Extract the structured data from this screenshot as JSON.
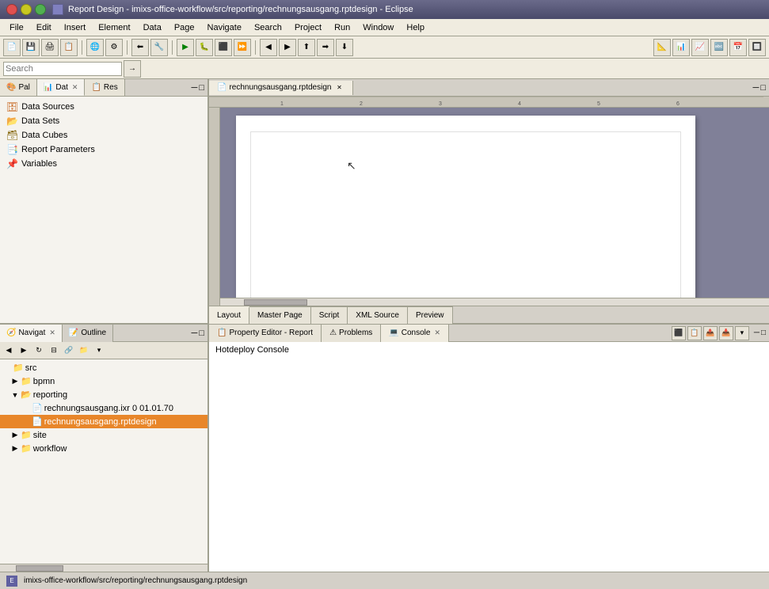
{
  "window": {
    "title": "Report Design - imixs-office-workflow/src/reporting/rechnungsausgang.rptdesign - Eclipse",
    "close_btn": "✕",
    "min_btn": "─",
    "max_btn": "□"
  },
  "menu": {
    "items": [
      "File",
      "Edit",
      "Insert",
      "Element",
      "Data",
      "Page",
      "Navigate",
      "Search",
      "Project",
      "Run",
      "Window",
      "Help"
    ]
  },
  "left_panel": {
    "tabs": [
      {
        "label": "Pal",
        "icon": "🎨",
        "active": false
      },
      {
        "label": "Dat",
        "icon": "📊",
        "active": true
      },
      {
        "label": "Res",
        "icon": "📋",
        "active": false
      }
    ],
    "tree_items": [
      {
        "label": "Data Sources",
        "icon": "ds",
        "indent": 0
      },
      {
        "label": "Data Sets",
        "icon": "ds",
        "indent": 0
      },
      {
        "label": "Data Cubes",
        "icon": "dc",
        "indent": 0
      },
      {
        "label": "Report Parameters",
        "icon": "rp",
        "indent": 0
      },
      {
        "label": "Variables",
        "icon": "var",
        "indent": 0
      }
    ]
  },
  "editor": {
    "tab_label": "rechnungsausgang.rptdesign",
    "tab_icon": "📄"
  },
  "bottom_tabs": {
    "tabs": [
      "Layout",
      "Master Page",
      "Script",
      "XML Source",
      "Preview"
    ]
  },
  "navigator": {
    "panel_tab": "Navigat",
    "outline_tab": "Outline",
    "tree_items": [
      {
        "label": "src",
        "type": "root",
        "indent": 0,
        "expanded": true
      },
      {
        "label": "bpmn",
        "type": "folder",
        "indent": 1,
        "expanded": false
      },
      {
        "label": "reporting",
        "type": "folder",
        "indent": 1,
        "expanded": true
      },
      {
        "label": "rechnungsausgang.ixr 0  01.01.70",
        "type": "file",
        "indent": 2,
        "selected": false
      },
      {
        "label": "rechnungsausgang.rptdesign",
        "type": "file",
        "indent": 2,
        "selected": true
      },
      {
        "label": "site",
        "type": "folder",
        "indent": 1,
        "expanded": false
      },
      {
        "label": "workflow",
        "type": "folder",
        "indent": 1,
        "expanded": false
      }
    ]
  },
  "property_editor": {
    "tab_label": "Property Editor - Report",
    "tab_icon": "📋",
    "problems_tab": "Problems",
    "console_tab": "Console",
    "console_title": "Hotdeploy Console"
  },
  "status_bar": {
    "path": "imixs-office-workflow/src/reporting/rechnungsausgang.rptdesign"
  },
  "search_bar": {
    "placeholder": "Search"
  }
}
